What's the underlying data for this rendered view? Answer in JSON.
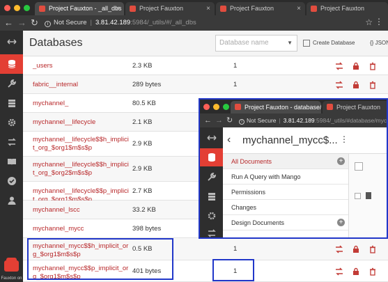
{
  "browser": {
    "tabs": [
      {
        "label": "Project Fauxton - _all_dbs",
        "active": true
      },
      {
        "label": "Project Fauxton",
        "active": false
      },
      {
        "label": "Project Fauxton",
        "active": false
      },
      {
        "label": "Project Fauxton",
        "active": false
      }
    ],
    "security": "Not Secure",
    "url_host": "3.81.42.189",
    "url_path": ":5984/_utils/#/_all_dbs"
  },
  "sidebar": {
    "items": [
      {
        "icon": "collapse-arrows-icon",
        "active": false
      },
      {
        "icon": "database-icon",
        "active": true
      },
      {
        "icon": "wrench-icon",
        "active": false
      },
      {
        "icon": "server-icon",
        "active": false
      },
      {
        "icon": "gear-icon",
        "active": false
      },
      {
        "icon": "replication-icon",
        "active": false
      },
      {
        "icon": "book-icon",
        "active": false
      },
      {
        "icon": "verify-icon",
        "active": false
      },
      {
        "icon": "user-icon",
        "active": false
      }
    ],
    "footer_label": "Fauxton on"
  },
  "header": {
    "title": "Databases",
    "search_placeholder": "Database name",
    "create_label": "Create Database",
    "json_label": "{} JSON"
  },
  "databases": [
    {
      "name": "_users",
      "size": "2.3 KB",
      "docs": "1"
    },
    {
      "name": "fabric__internal",
      "size": "289 bytes",
      "docs": "1"
    },
    {
      "name": "mychannel_",
      "size": "80.5 KB",
      "docs": ""
    },
    {
      "name": "mychannel__lifecycle",
      "size": "2.1 KB",
      "docs": ""
    },
    {
      "name": "mychannel__lifecycle$$h_implicit_org_$org1$m$s$p",
      "size": "2.9 KB",
      "docs": ""
    },
    {
      "name": "mychannel__lifecycle$$h_implicit_org_$org2$m$s$p",
      "size": "2.9 KB",
      "docs": ""
    },
    {
      "name": "mychannel__lifecycle$$p_implicit_org_$org1$m$s$p",
      "size": "2.7 KB",
      "docs": ""
    },
    {
      "name": "mychannel_lscc",
      "size": "33.2 KB",
      "docs": ""
    },
    {
      "name": "mychannel_mycc",
      "size": "398 bytes",
      "docs": ""
    },
    {
      "name": "mychannel_mycc$$h_implicit_org_$org1$m$s$p",
      "size": "0.5 KB",
      "docs": "1"
    },
    {
      "name": "mychannel_mycc$$p_implicit_org_$org1$m$s$p",
      "size": "401 bytes",
      "docs": "1"
    }
  ],
  "overlay": {
    "tabs": [
      {
        "label": "Project Fauxton - database/myc",
        "active": true
      },
      {
        "label": "Project Fauxton",
        "active": false
      }
    ],
    "security": "Not Secure",
    "url_host": "3.81.42.189",
    "url_path": ":5984/_utils/#database/mych",
    "db_title": "mychannel_mycc$...",
    "menu": [
      {
        "label": "All Documents",
        "active": true,
        "plus": true
      },
      {
        "label": "Run A Query with Mango",
        "active": false,
        "plus": false
      },
      {
        "label": "Permissions",
        "active": false,
        "plus": false
      },
      {
        "label": "Changes",
        "active": false,
        "plus": false
      },
      {
        "label": "Design Documents",
        "active": false,
        "plus": true
      }
    ]
  },
  "colors": {
    "accent": "#e33f34",
    "link": "#b8282a",
    "highlight_border": "#2137c9"
  }
}
